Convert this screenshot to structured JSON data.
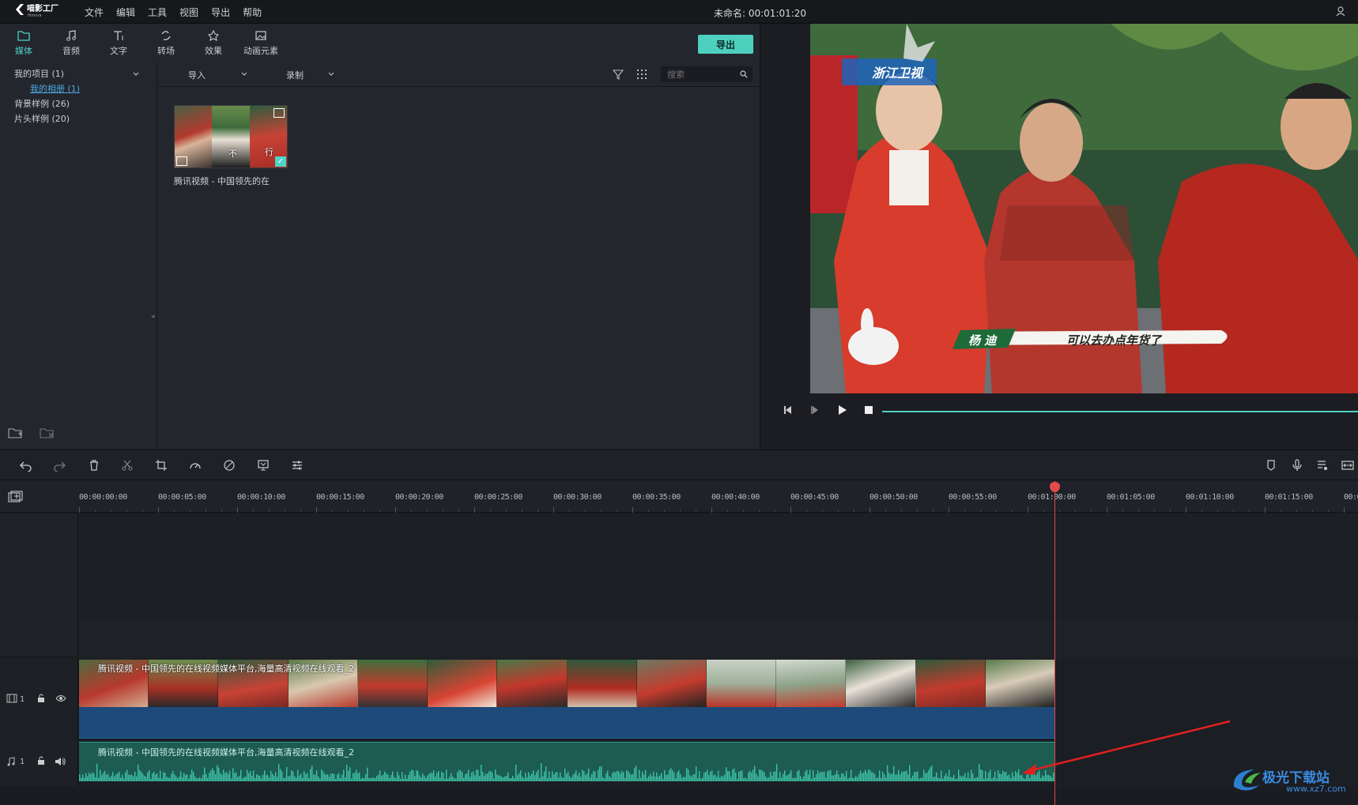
{
  "app": {
    "logo_text": "喵影工厂",
    "logo_sub": "filmora",
    "menu": [
      "文件",
      "编辑",
      "工具",
      "视图",
      "导出",
      "帮助"
    ],
    "doc_title": "未命名: 00:01:01:20"
  },
  "tabs": [
    {
      "label": "媒体",
      "icon": "folder-icon",
      "active": true
    },
    {
      "label": "音频",
      "icon": "music-note-icon",
      "active": false
    },
    {
      "label": "文字",
      "icon": "text-icon",
      "active": false
    },
    {
      "label": "转场",
      "icon": "transition-icon",
      "active": false
    },
    {
      "label": "效果",
      "icon": "effects-icon",
      "active": false
    },
    {
      "label": "动画元素",
      "icon": "image-icon",
      "active": false
    }
  ],
  "export_label": "导出",
  "sidebar": {
    "items": [
      {
        "label": "我的项目 (1)",
        "expanded": true
      },
      {
        "label": "我的相册 (1)",
        "sub": true
      },
      {
        "label": "背景样例 (26)"
      },
      {
        "label": "片头样例 (20)"
      }
    ]
  },
  "media_bar": {
    "import_label": "导入",
    "record_label": "录制",
    "search_placeholder": "搜索"
  },
  "media_items": [
    {
      "caption": "腾讯视频 - 中国领先的在",
      "frame_text": [
        "",
        "不",
        "行"
      ]
    }
  ],
  "preview": {
    "channel_logo": "浙江卫视",
    "subtitle_name": "杨 迪",
    "subtitle_text": "可以去办点年货了"
  },
  "timeline": {
    "ticks": [
      "00:00:00:00",
      "00:00:05:00",
      "00:00:10:00",
      "00:00:15:00",
      "00:00:20:00",
      "00:00:25:00",
      "00:00:30:00",
      "00:00:35:00",
      "00:00:40:00",
      "00:00:45:00",
      "00:00:50:00",
      "00:00:55:00",
      "00:01:00:00",
      "00:01:05:00",
      "00:01:10:00",
      "00:01:15:00",
      "00:0"
    ],
    "video_track_num": "1",
    "audio_track_num": "1",
    "video_clip_label": "腾讯视频 - 中国领先的在线视频媒体平台,海量高清视频在线观看_2",
    "audio_clip_label": "腾讯视频 - 中国领先的在线视频媒体平台,海量高清视频在线观看_2"
  },
  "watermark": {
    "title": "极光下载站",
    "url": "www.xz7.com"
  },
  "colors": {
    "accent": "#4fd1c5",
    "playhead": "#e24b4b",
    "video_under": "#1e4a7a",
    "audio_clip": "#1c5c52"
  }
}
